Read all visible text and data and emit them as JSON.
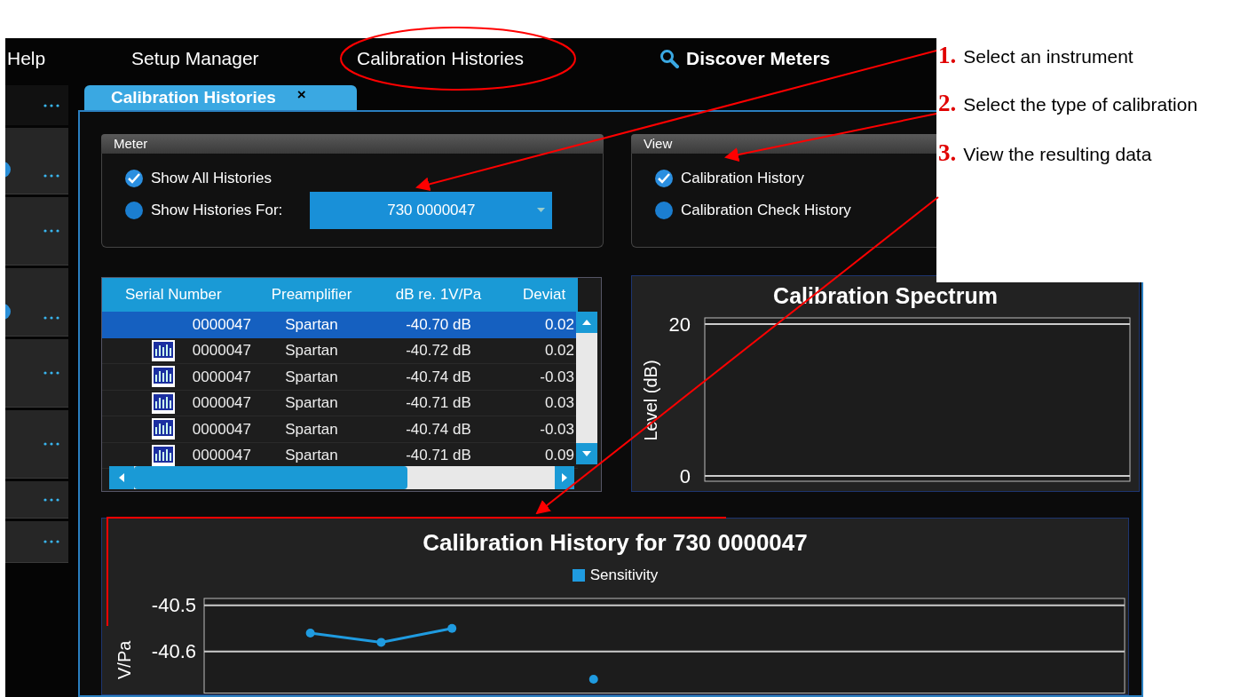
{
  "menu": [
    {
      "label": "Help",
      "kind": "text"
    },
    {
      "label": "Setup Manager",
      "kind": "text"
    },
    {
      "label": "Calibration Histories",
      "kind": "text"
    },
    {
      "label": "Discover Meters",
      "kind": "search"
    }
  ],
  "sidebar": {
    "rows": [
      {
        "kind": "header",
        "info_icon": false
      },
      {
        "kind": "item",
        "info_icon": true
      },
      {
        "kind": "item",
        "info_icon": false
      },
      {
        "kind": "item",
        "info_icon": true
      },
      {
        "kind": "item",
        "info_icon": false
      },
      {
        "kind": "item",
        "info_icon": false
      },
      {
        "kind": "item",
        "info_icon": false
      },
      {
        "kind": "item",
        "info_icon": false
      }
    ]
  },
  "tab": {
    "label": "Calibration Histories",
    "close": "×"
  },
  "meter": {
    "title": "Meter",
    "options": [
      {
        "label": "Show All Histories",
        "selected": true
      },
      {
        "label": "Show Histories For:",
        "selected": false
      }
    ],
    "dropdown": "730 0000047"
  },
  "view": {
    "title": "View",
    "options": [
      {
        "label": "Calibration History",
        "selected": true
      },
      {
        "label": "Calibration Check History",
        "selected": false
      }
    ]
  },
  "table": {
    "columns": [
      "Serial Number",
      "Preamplifier",
      "dB re. 1V/Pa",
      "Deviat"
    ],
    "rows": [
      {
        "selected": true,
        "cells": [
          "0000047",
          "Spartan",
          "-40.70 dB",
          "0.02"
        ]
      },
      {
        "selected": false,
        "cells": [
          "0000047",
          "Spartan",
          "-40.72 dB",
          "0.02"
        ]
      },
      {
        "selected": false,
        "cells": [
          "0000047",
          "Spartan",
          "-40.74 dB",
          "-0.03"
        ]
      },
      {
        "selected": false,
        "cells": [
          "0000047",
          "Spartan",
          "-40.71 dB",
          "0.03"
        ]
      },
      {
        "selected": false,
        "cells": [
          "0000047",
          "Spartan",
          "-40.74 dB",
          "-0.03"
        ]
      },
      {
        "selected": false,
        "cells": [
          "0000047",
          "Spartan",
          "-40.71 dB",
          "0.09"
        ]
      }
    ]
  },
  "spectrum": {
    "title": "Calibration Spectrum",
    "ylabel": "Level (dB)",
    "tick_labels": [
      "20",
      "0"
    ]
  },
  "history": {
    "chart_data": {
      "type": "line",
      "title": "Calibration History for 730 0000047",
      "ylabel": "V/Pa",
      "categories": [
        null,
        null,
        null,
        null,
        null,
        null,
        null,
        null,
        null,
        null,
        null,
        null,
        null
      ],
      "ylim": [
        -40.69,
        -40.485
      ],
      "yticks": [
        -40.5,
        -40.6
      ],
      "series": [
        {
          "name": "Sensitivity",
          "color": "#1f9be0",
          "marker": "circle",
          "values": [
            null,
            -40.56,
            -40.58,
            -40.55,
            null,
            -40.66,
            null,
            null,
            null,
            null,
            null,
            null,
            null
          ]
        }
      ]
    }
  },
  "annotations": [
    {
      "number": "1.",
      "text": "Select an instrument"
    },
    {
      "number": "2.",
      "text": "Select the type of calibration"
    },
    {
      "number": "3.",
      "text": "View the resulting data"
    }
  ]
}
